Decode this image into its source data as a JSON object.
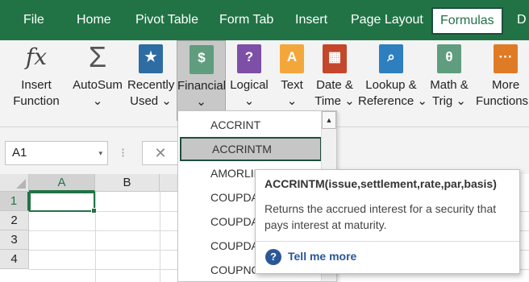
{
  "menu": {
    "tabs": [
      "File",
      "Home",
      "Pivot Table",
      "Form Tab",
      "Insert",
      "Page Layout",
      "Formulas",
      "D"
    ]
  },
  "ribbon": {
    "insert_function": {
      "icon_text": "fx",
      "line1": "Insert",
      "line2": "Function"
    },
    "autosum": {
      "icon_text": "Σ",
      "line1": "AutoSum",
      "line2": "⌄"
    },
    "recently_used": {
      "icon_text": "★",
      "line1": "Recently",
      "line2": "Used ⌄"
    },
    "financial": {
      "icon_text": "$",
      "line1": "Financial",
      "line2": "⌄"
    },
    "logical": {
      "icon_text": "?",
      "line1": "Logical",
      "line2": "⌄"
    },
    "text": {
      "icon_text": "A",
      "line1": "Text",
      "line2": "⌄"
    },
    "date_time": {
      "icon_text": "▦",
      "line1": "Date &",
      "line2": "Time ⌄"
    },
    "lookup": {
      "icon_text": "⌕",
      "line1": "Lookup &",
      "line2": "Reference ⌄"
    },
    "math_trig": {
      "icon_text": "θ",
      "line1": "Math &",
      "line2": "Trig ⌄"
    },
    "more": {
      "icon_text": "···",
      "line1": "More",
      "line2": "Functions"
    }
  },
  "formula_bar": {
    "name_box": "A1",
    "name_box_arrow": "▾",
    "separator": "⁝",
    "cancel_symbol": "✕"
  },
  "grid": {
    "columns": [
      "A",
      "B"
    ],
    "rows": [
      "1",
      "2",
      "3",
      "4"
    ]
  },
  "dropdown": {
    "items": [
      "ACCRINT",
      "ACCRINTM",
      "AMORLINC",
      "COUPDAYBS",
      "COUPDAYS",
      "COUPDAYSNC",
      "COUPNCD"
    ],
    "scroll_up": "▲"
  },
  "tooltip": {
    "title": "ACCRINTM(issue,settlement,rate,par,basis)",
    "description": "Returns the accrued interest for a security that pays interest at maturity.",
    "help_icon": "?",
    "link": "Tell me more"
  },
  "colors": {
    "accent": "#217346",
    "financial_icon": "#5f9d7e",
    "autosum_icon": "#555555",
    "recently_used_icon": "#2e6ca4",
    "logical_icon": "#7e4fa6",
    "text_icon": "#f3a73b",
    "date_time_icon": "#c5472b",
    "lookup_icon": "#2e7fbf",
    "math_trig_icon": "#5f9d7e",
    "more_icon": "#e07b25",
    "link": "#2b5797"
  }
}
